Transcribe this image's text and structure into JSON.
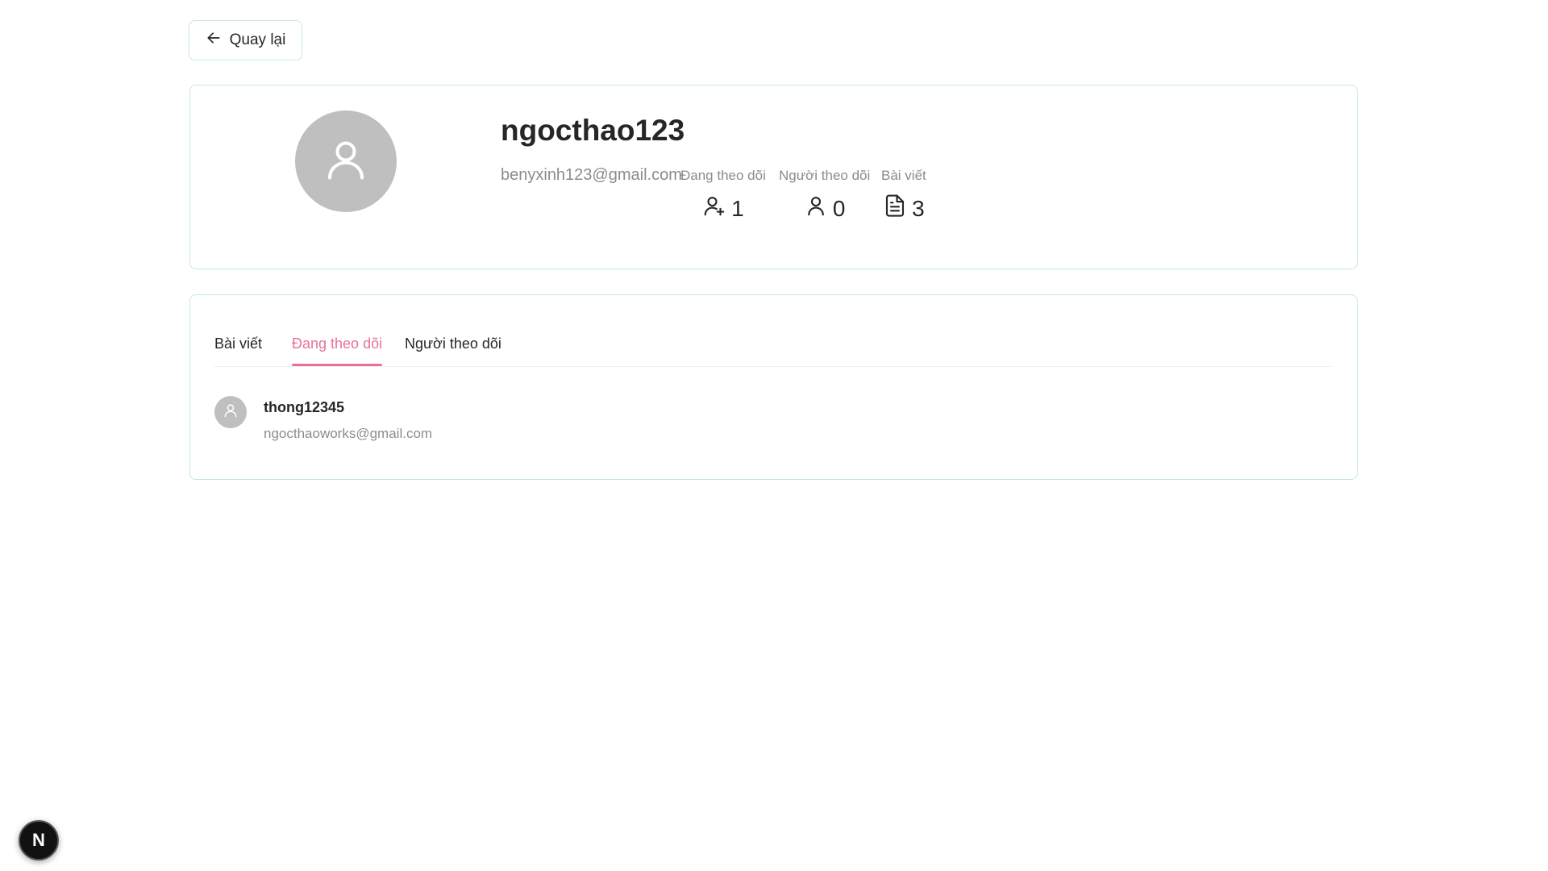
{
  "header": {
    "back_label": "Quay lại",
    "back_icon": "arrow-left-icon"
  },
  "profile": {
    "avatar_icon": "user-icon",
    "username": "ngocthao123",
    "email": "benyxinh123@gmail.com",
    "stats": [
      {
        "label": "Đang theo dõi",
        "value": "1",
        "icon": "user-plus-icon"
      },
      {
        "label": "Người theo dõi",
        "value": "0",
        "icon": "user-icon"
      },
      {
        "label": "Bài viết",
        "value": "3",
        "icon": "file-text-icon"
      }
    ]
  },
  "tabs": {
    "items": [
      {
        "label": "Bài viết"
      },
      {
        "label": "Đang theo dõi"
      },
      {
        "label": "Người theo dõi"
      }
    ],
    "active_index": 1,
    "accent_color": "#e8719b"
  },
  "following_list": [
    {
      "name": "thong12345",
      "email": "ngocthaoworks@gmail.com",
      "avatar_icon": "user-icon"
    }
  ],
  "dev_badge": {
    "label": "N"
  }
}
